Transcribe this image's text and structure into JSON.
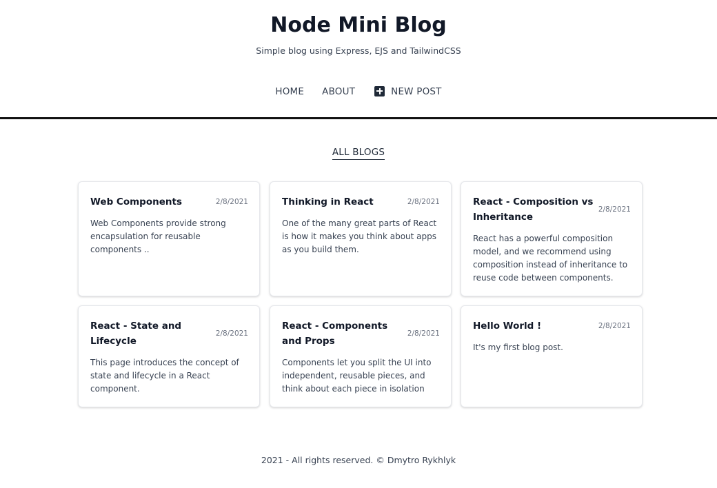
{
  "header": {
    "title": "Node Mini Blog",
    "subtitle": "Simple blog using Express, EJS and TailwindCSS",
    "nav": {
      "home": "HOME",
      "about": "ABOUT",
      "new_post": "NEW POST",
      "new_post_icon": "plus-square-icon"
    }
  },
  "main": {
    "heading": "ALL BLOGS",
    "posts": [
      {
        "title": "Web Components",
        "date": "2/8/2021",
        "snippet": "Web Components provide strong encapsulation for reusable components .."
      },
      {
        "title": "Thinking in React",
        "date": "2/8/2021",
        "snippet": "One of the many great parts of React is how it makes you think about apps as you build them."
      },
      {
        "title": "React - Composition vs Inheritance",
        "date": "2/8/2021",
        "snippet": "React has a powerful composition model, and we recommend using composition instead of inheritance to reuse code between components."
      },
      {
        "title": "React - State and Lifecycle",
        "date": "2/8/2021",
        "snippet": "This page introduces the concept of state and lifecycle in a React component."
      },
      {
        "title": "React - Components and Props",
        "date": "2/8/2021",
        "snippet": "Components let you split the UI into independent, reusable pieces, and think about each piece in isolation"
      },
      {
        "title": "Hello World !",
        "date": "2/8/2021",
        "snippet": "It's my first blog post."
      }
    ]
  },
  "footer": {
    "text": "2021 - All rights reserved. © Dmytro Rykhlyk"
  }
}
